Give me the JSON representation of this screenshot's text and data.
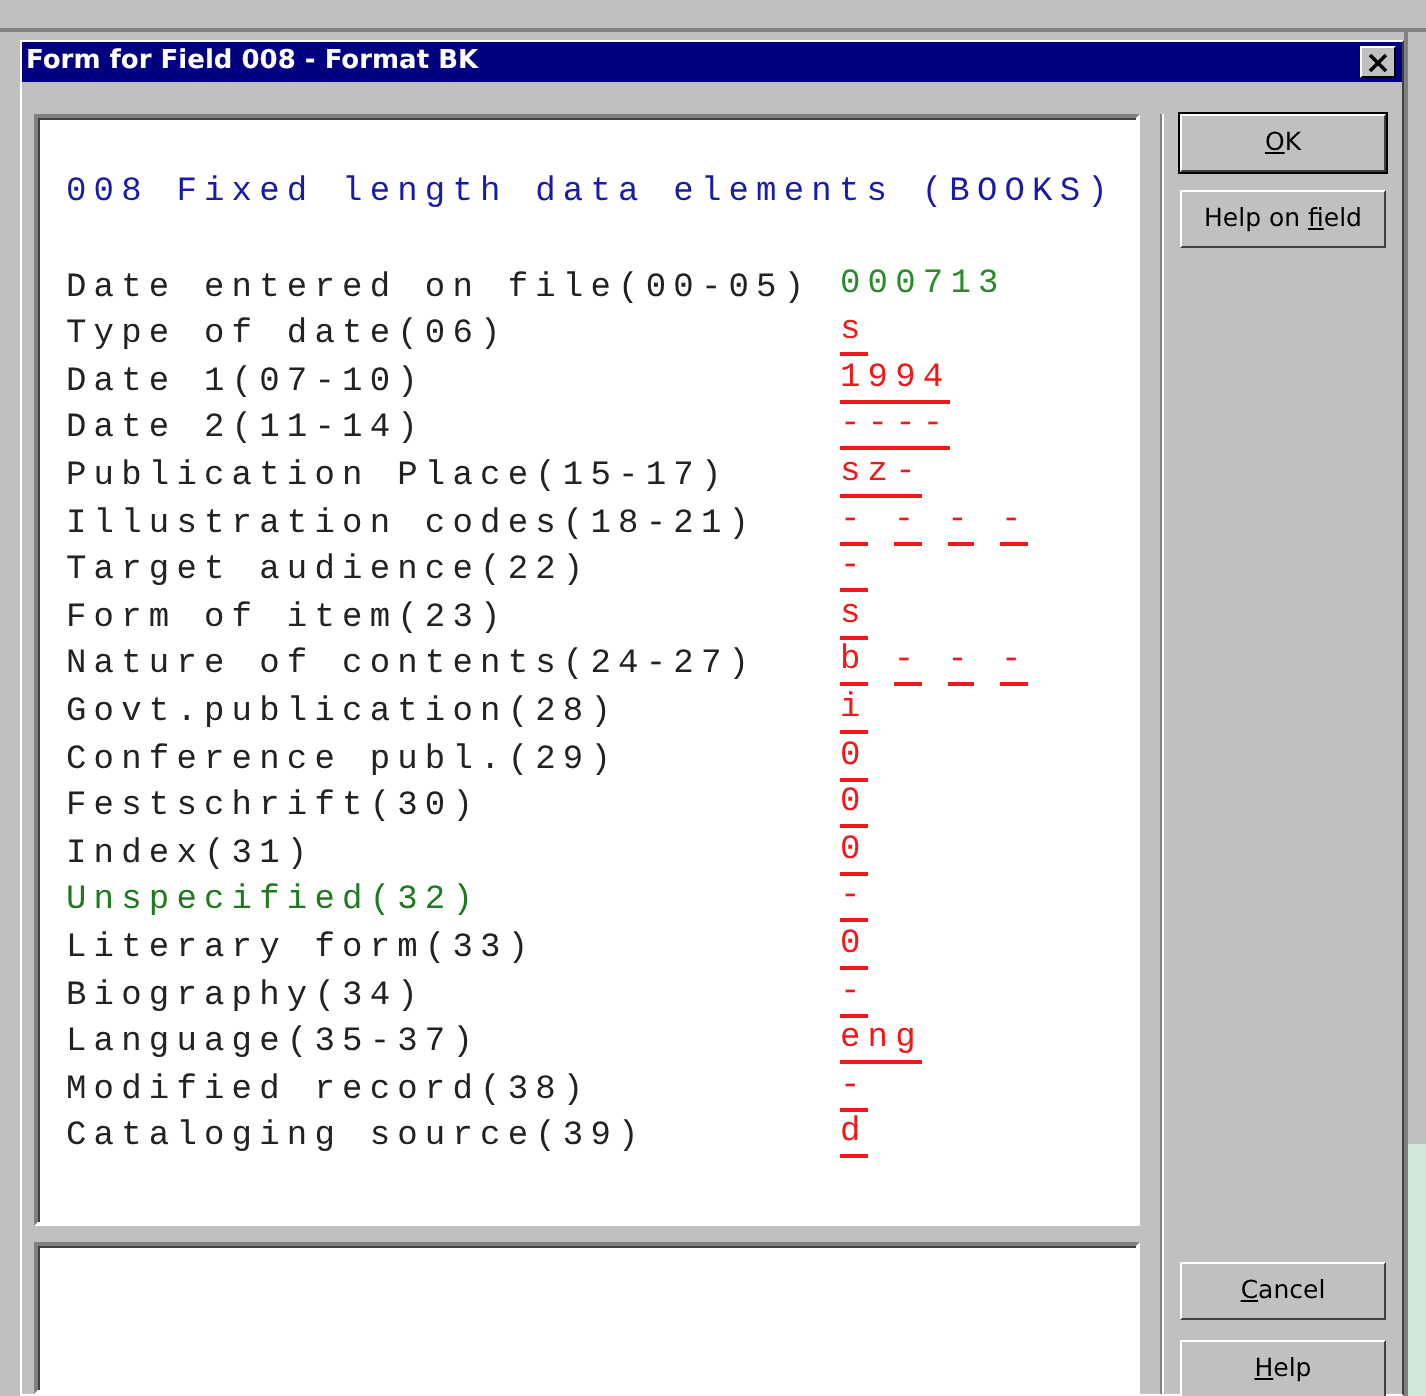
{
  "window": {
    "title": "Form for Field 008 - Format BK"
  },
  "heading": "008 Fixed length data elements (BOOKS)",
  "fields": [
    {
      "label": "Date entered on file(00-05)",
      "kind": "readonly",
      "highlighted": false,
      "values": [
        "000713"
      ]
    },
    {
      "label": "Type of date(06)",
      "kind": "editable",
      "highlighted": false,
      "values": [
        "s"
      ]
    },
    {
      "label": "Date 1(07-10)",
      "kind": "editable",
      "highlighted": false,
      "values": [
        "1994"
      ]
    },
    {
      "label": "Date 2(11-14)",
      "kind": "editable",
      "highlighted": false,
      "values": [
        "----"
      ]
    },
    {
      "label": "Publication Place(15-17)",
      "kind": "editable",
      "highlighted": false,
      "values": [
        "sz-"
      ]
    },
    {
      "label": "Illustration codes(18-21)",
      "kind": "editable",
      "highlighted": false,
      "values": [
        "-",
        "-",
        "-",
        "-"
      ]
    },
    {
      "label": "Target audience(22)",
      "kind": "editable",
      "highlighted": false,
      "values": [
        "-"
      ]
    },
    {
      "label": "Form of item(23)",
      "kind": "editable",
      "highlighted": false,
      "values": [
        "s"
      ]
    },
    {
      "label": "Nature of contents(24-27)",
      "kind": "editable",
      "highlighted": false,
      "values": [
        "b",
        "-",
        "-",
        "-"
      ]
    },
    {
      "label": "Govt.publication(28)",
      "kind": "editable",
      "highlighted": false,
      "values": [
        "i"
      ]
    },
    {
      "label": "Conference publ.(29)",
      "kind": "editable",
      "highlighted": false,
      "values": [
        "0"
      ]
    },
    {
      "label": "Festschrift(30)",
      "kind": "editable",
      "highlighted": false,
      "values": [
        "0"
      ]
    },
    {
      "label": "Index(31)",
      "kind": "editable",
      "highlighted": false,
      "values": [
        "0"
      ]
    },
    {
      "label": "Unspecified(32)",
      "kind": "editable",
      "highlighted": true,
      "values": [
        "-"
      ]
    },
    {
      "label": "Literary form(33)",
      "kind": "editable",
      "highlighted": false,
      "values": [
        "0"
      ]
    },
    {
      "label": "Biography(34)",
      "kind": "editable",
      "highlighted": false,
      "values": [
        "-"
      ]
    },
    {
      "label": "Language(35-37)",
      "kind": "editable",
      "highlighted": false,
      "values": [
        "eng"
      ]
    },
    {
      "label": "Modified record(38)",
      "kind": "editable",
      "highlighted": false,
      "values": [
        "-"
      ]
    },
    {
      "label": "Cataloging source(39)",
      "kind": "editable",
      "highlighted": false,
      "values": [
        "d"
      ]
    }
  ],
  "top_buttons": [
    {
      "hotkey": "O",
      "after": "K",
      "default": true
    },
    {
      "before": "Help on ",
      "hotkey": "f",
      "after": "ield",
      "default": false
    }
  ],
  "bottom_buttons": [
    {
      "hotkey": "C",
      "after": "ancel",
      "default": false
    },
    {
      "hotkey": "H",
      "after": "elp",
      "default": false
    }
  ]
}
